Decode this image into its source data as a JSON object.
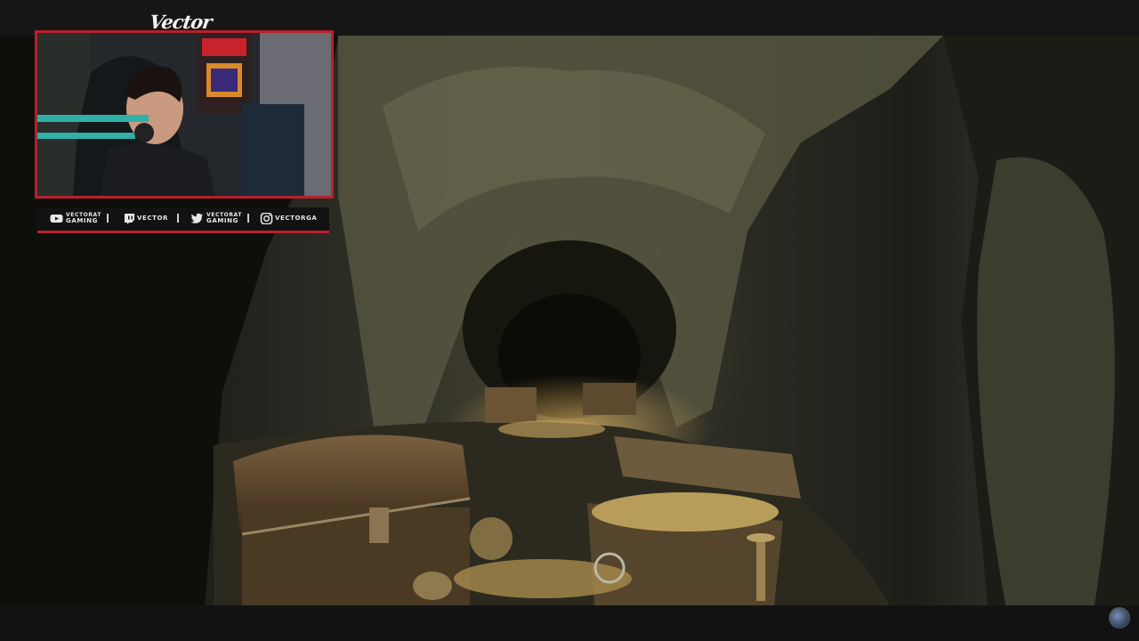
{
  "stream": {
    "webcam_title": "Vector",
    "social": [
      {
        "icon": "youtube-icon",
        "label_small": "VECTORAT",
        "label_big": "GAMING"
      },
      {
        "icon": "twitch-icon",
        "label": "VECTOR"
      },
      {
        "icon": "twitter-icon",
        "label_small": "VECTORAT",
        "label_big": "GAMING"
      },
      {
        "icon": "instagram-icon",
        "label": "VECTORGA"
      }
    ]
  },
  "colors": {
    "frame_accent": "#b8202c",
    "bar_background": "#121212"
  }
}
